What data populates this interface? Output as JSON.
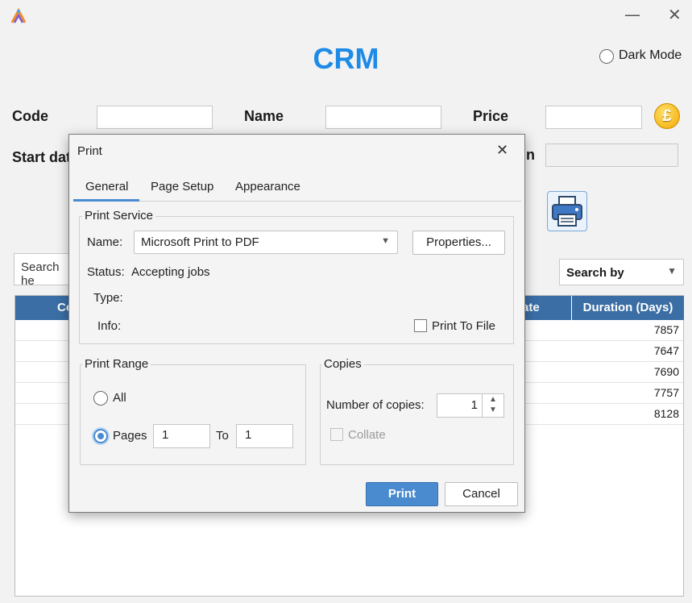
{
  "app": {
    "title": "CRM",
    "dark_mode_label": "Dark Mode",
    "minimize": "—",
    "close": "✕"
  },
  "form": {
    "code_label": "Code",
    "name_label": "Name",
    "price_label": "Price",
    "start_date_label": "Start dat",
    "duration_label_partial": "n",
    "currency_symbol": "£"
  },
  "search": {
    "placeholder": "Search he",
    "search_by": "Search by"
  },
  "table": {
    "headers": [
      "Co",
      "ate",
      "Duration (Days)"
    ],
    "duration_values": [
      "7857",
      "7647",
      "7690",
      "7757",
      "8128"
    ]
  },
  "dialog": {
    "title": "Print",
    "close": "✕",
    "tabs": [
      "General",
      "Page Setup",
      "Appearance"
    ],
    "print_service": {
      "legend": "Print Service",
      "name_label": "Name:",
      "name_value": "Microsoft Print to PDF",
      "properties_button": "Properties...",
      "status_label": "Status:",
      "status_value": "Accepting jobs",
      "type_label": "Type:",
      "info_label": "Info:",
      "print_to_file": "Print To File"
    },
    "print_range": {
      "legend": "Print Range",
      "all_label": "All",
      "pages_label": "Pages",
      "from_value": "1",
      "to_label": "To",
      "to_value": "1"
    },
    "copies": {
      "legend": "Copies",
      "number_label": "Number of copies:",
      "number_value": "1",
      "collate_label": "Collate"
    },
    "print_button": "Print",
    "cancel_button": "Cancel"
  },
  "colors": {
    "accent": "#1e8be6",
    "table_header": "#3a6ea5",
    "primary_button": "#4a8bd0"
  }
}
